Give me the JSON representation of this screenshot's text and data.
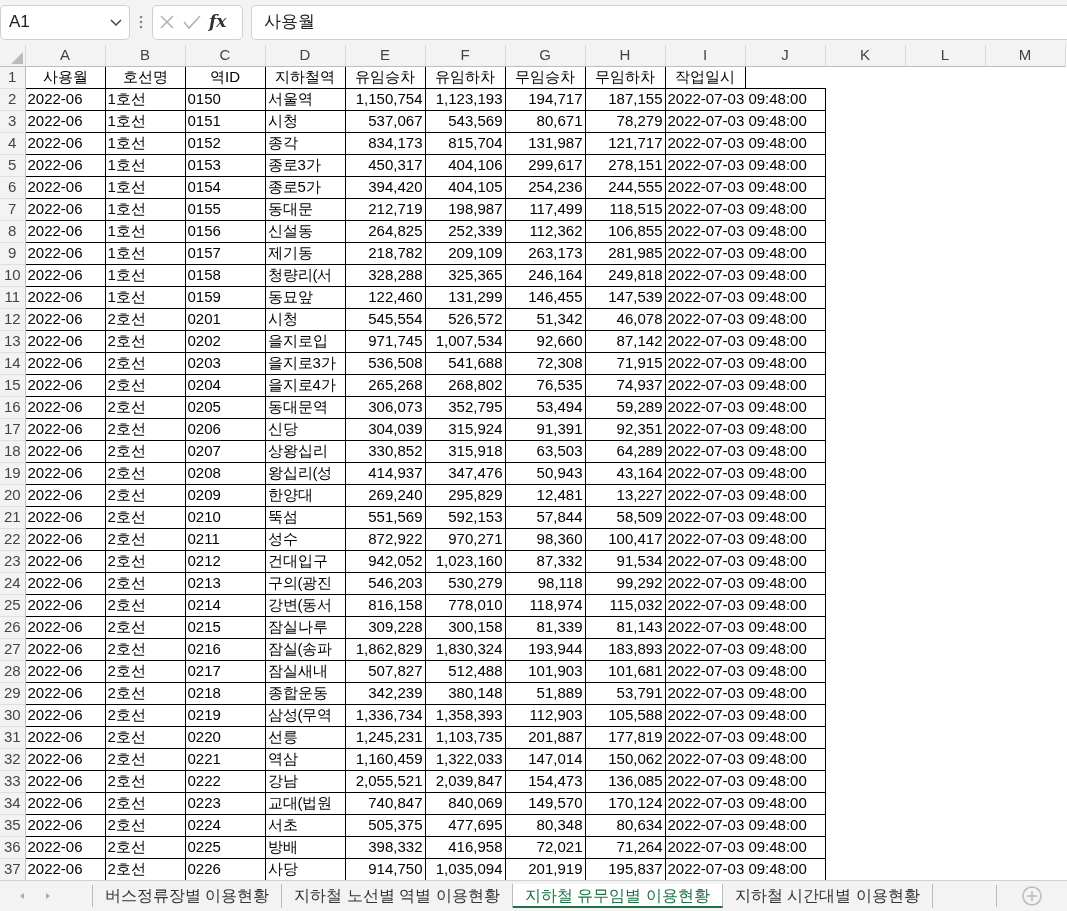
{
  "formula_bar": {
    "name_box": "A1",
    "function_label": "fx",
    "formula": "사용월"
  },
  "columns": [
    "A",
    "B",
    "C",
    "D",
    "E",
    "F",
    "G",
    "H",
    "I",
    "J",
    "K",
    "L",
    "M"
  ],
  "rows": [
    {
      "row_number": "1",
      "kind": "header",
      "cells": [
        "사용월",
        "호선명",
        "역ID",
        "지하철역",
        "유임승차",
        "유임하차",
        "무임승차",
        "무임하차",
        "작업일시"
      ]
    },
    {
      "row_number": "2",
      "kind": "data",
      "cells": [
        "2022-06",
        "1호선",
        "0150",
        "서울역",
        "1,150,754",
        "1,123,193",
        "194,717",
        "187,155",
        "2022-07-03 09:48:00"
      ]
    },
    {
      "row_number": "3",
      "kind": "data",
      "cells": [
        "2022-06",
        "1호선",
        "0151",
        "시청",
        "537,067",
        "543,569",
        "80,671",
        "78,279",
        "2022-07-03 09:48:00"
      ]
    },
    {
      "row_number": "4",
      "kind": "data",
      "cells": [
        "2022-06",
        "1호선",
        "0152",
        "종각",
        "834,173",
        "815,704",
        "131,987",
        "121,717",
        "2022-07-03 09:48:00"
      ]
    },
    {
      "row_number": "5",
      "kind": "data",
      "cells": [
        "2022-06",
        "1호선",
        "0153",
        "종로3가",
        "450,317",
        "404,106",
        "299,617",
        "278,151",
        "2022-07-03 09:48:00"
      ]
    },
    {
      "row_number": "6",
      "kind": "data",
      "cells": [
        "2022-06",
        "1호선",
        "0154",
        "종로5가",
        "394,420",
        "404,105",
        "254,236",
        "244,555",
        "2022-07-03 09:48:00"
      ]
    },
    {
      "row_number": "7",
      "kind": "data",
      "cells": [
        "2022-06",
        "1호선",
        "0155",
        "동대문",
        "212,719",
        "198,987",
        "117,499",
        "118,515",
        "2022-07-03 09:48:00"
      ]
    },
    {
      "row_number": "8",
      "kind": "data",
      "cells": [
        "2022-06",
        "1호선",
        "0156",
        "신설동",
        "264,825",
        "252,339",
        "112,362",
        "106,855",
        "2022-07-03 09:48:00"
      ]
    },
    {
      "row_number": "9",
      "kind": "data",
      "cells": [
        "2022-06",
        "1호선",
        "0157",
        "제기동",
        "218,782",
        "209,109",
        "263,173",
        "281,985",
        "2022-07-03 09:48:00"
      ]
    },
    {
      "row_number": "10",
      "kind": "data",
      "cells": [
        "2022-06",
        "1호선",
        "0158",
        "청량리(서",
        "328,288",
        "325,365",
        "246,164",
        "249,818",
        "2022-07-03 09:48:00"
      ]
    },
    {
      "row_number": "11",
      "kind": "data",
      "cells": [
        "2022-06",
        "1호선",
        "0159",
        "동묘앞",
        "122,460",
        "131,299",
        "146,455",
        "147,539",
        "2022-07-03 09:48:00"
      ]
    },
    {
      "row_number": "12",
      "kind": "data",
      "cells": [
        "2022-06",
        "2호선",
        "0201",
        "시청",
        "545,554",
        "526,572",
        "51,342",
        "46,078",
        "2022-07-03 09:48:00"
      ]
    },
    {
      "row_number": "13",
      "kind": "data",
      "cells": [
        "2022-06",
        "2호선",
        "0202",
        "을지로입",
        "971,745",
        "1,007,534",
        "92,660",
        "87,142",
        "2022-07-03 09:48:00"
      ]
    },
    {
      "row_number": "14",
      "kind": "data",
      "cells": [
        "2022-06",
        "2호선",
        "0203",
        "을지로3가",
        "536,508",
        "541,688",
        "72,308",
        "71,915",
        "2022-07-03 09:48:00"
      ]
    },
    {
      "row_number": "15",
      "kind": "data",
      "cells": [
        "2022-06",
        "2호선",
        "0204",
        "을지로4가",
        "265,268",
        "268,802",
        "76,535",
        "74,937",
        "2022-07-03 09:48:00"
      ]
    },
    {
      "row_number": "16",
      "kind": "data",
      "cells": [
        "2022-06",
        "2호선",
        "0205",
        "동대문역",
        "306,073",
        "352,795",
        "53,494",
        "59,289",
        "2022-07-03 09:48:00"
      ]
    },
    {
      "row_number": "17",
      "kind": "data",
      "cells": [
        "2022-06",
        "2호선",
        "0206",
        "신당",
        "304,039",
        "315,924",
        "91,391",
        "92,351",
        "2022-07-03 09:48:00"
      ]
    },
    {
      "row_number": "18",
      "kind": "data",
      "cells": [
        "2022-06",
        "2호선",
        "0207",
        "상왕십리",
        "330,852",
        "315,918",
        "63,503",
        "64,289",
        "2022-07-03 09:48:00"
      ]
    },
    {
      "row_number": "19",
      "kind": "data",
      "cells": [
        "2022-06",
        "2호선",
        "0208",
        "왕십리(성",
        "414,937",
        "347,476",
        "50,943",
        "43,164",
        "2022-07-03 09:48:00"
      ]
    },
    {
      "row_number": "20",
      "kind": "data",
      "cells": [
        "2022-06",
        "2호선",
        "0209",
        "한양대",
        "269,240",
        "295,829",
        "12,481",
        "13,227",
        "2022-07-03 09:48:00"
      ]
    },
    {
      "row_number": "21",
      "kind": "data",
      "cells": [
        "2022-06",
        "2호선",
        "0210",
        "뚝섬",
        "551,569",
        "592,153",
        "57,844",
        "58,509",
        "2022-07-03 09:48:00"
      ]
    },
    {
      "row_number": "22",
      "kind": "data",
      "cells": [
        "2022-06",
        "2호선",
        "0211",
        "성수",
        "872,922",
        "970,271",
        "98,360",
        "100,417",
        "2022-07-03 09:48:00"
      ]
    },
    {
      "row_number": "23",
      "kind": "data",
      "cells": [
        "2022-06",
        "2호선",
        "0212",
        "건대입구",
        "942,052",
        "1,023,160",
        "87,332",
        "91,534",
        "2022-07-03 09:48:00"
      ]
    },
    {
      "row_number": "24",
      "kind": "data",
      "cells": [
        "2022-06",
        "2호선",
        "0213",
        "구의(광진",
        "546,203",
        "530,279",
        "98,118",
        "99,292",
        "2022-07-03 09:48:00"
      ]
    },
    {
      "row_number": "25",
      "kind": "data",
      "cells": [
        "2022-06",
        "2호선",
        "0214",
        "강변(동서",
        "816,158",
        "778,010",
        "118,974",
        "115,032",
        "2022-07-03 09:48:00"
      ]
    },
    {
      "row_number": "26",
      "kind": "data",
      "cells": [
        "2022-06",
        "2호선",
        "0215",
        "잠실나루",
        "309,228",
        "300,158",
        "81,339",
        "81,143",
        "2022-07-03 09:48:00"
      ]
    },
    {
      "row_number": "27",
      "kind": "data",
      "cells": [
        "2022-06",
        "2호선",
        "0216",
        "잠실(송파",
        "1,862,829",
        "1,830,324",
        "193,944",
        "183,893",
        "2022-07-03 09:48:00"
      ]
    },
    {
      "row_number": "28",
      "kind": "data",
      "cells": [
        "2022-06",
        "2호선",
        "0217",
        "잠실새내",
        "507,827",
        "512,488",
        "101,903",
        "101,681",
        "2022-07-03 09:48:00"
      ]
    },
    {
      "row_number": "29",
      "kind": "data",
      "cells": [
        "2022-06",
        "2호선",
        "0218",
        "종합운동",
        "342,239",
        "380,148",
        "51,889",
        "53,791",
        "2022-07-03 09:48:00"
      ]
    },
    {
      "row_number": "30",
      "kind": "data",
      "cells": [
        "2022-06",
        "2호선",
        "0219",
        "삼성(무역",
        "1,336,734",
        "1,358,393",
        "112,903",
        "105,588",
        "2022-07-03 09:48:00"
      ]
    },
    {
      "row_number": "31",
      "kind": "data",
      "cells": [
        "2022-06",
        "2호선",
        "0220",
        "선릉",
        "1,245,231",
        "1,103,735",
        "201,887",
        "177,819",
        "2022-07-03 09:48:00"
      ]
    },
    {
      "row_number": "32",
      "kind": "data",
      "cells": [
        "2022-06",
        "2호선",
        "0221",
        "역삼",
        "1,160,459",
        "1,322,033",
        "147,014",
        "150,062",
        "2022-07-03 09:48:00"
      ]
    },
    {
      "row_number": "33",
      "kind": "data",
      "cells": [
        "2022-06",
        "2호선",
        "0222",
        "강남",
        "2,055,521",
        "2,039,847",
        "154,473",
        "136,085",
        "2022-07-03 09:48:00"
      ]
    },
    {
      "row_number": "34",
      "kind": "data",
      "cells": [
        "2022-06",
        "2호선",
        "0223",
        "교대(법원",
        "740,847",
        "840,069",
        "149,570",
        "170,124",
        "2022-07-03 09:48:00"
      ]
    },
    {
      "row_number": "35",
      "kind": "data",
      "cells": [
        "2022-06",
        "2호선",
        "0224",
        "서초",
        "505,375",
        "477,695",
        "80,348",
        "80,634",
        "2022-07-03 09:48:00"
      ]
    },
    {
      "row_number": "36",
      "kind": "data",
      "cells": [
        "2022-06",
        "2호선",
        "0225",
        "방배",
        "398,332",
        "416,958",
        "72,021",
        "71,264",
        "2022-07-03 09:48:00"
      ]
    },
    {
      "row_number": "37",
      "kind": "data",
      "cells": [
        "2022-06",
        "2호선",
        "0226",
        "사당",
        "914,750",
        "1,035,094",
        "201,919",
        "195,837",
        "2022-07-03 09:48:00"
      ]
    }
  ],
  "sheet_tabs": [
    {
      "label": "버스정류장별 이용현황",
      "selected": false
    },
    {
      "label": "지하철 노선별 역별 이용현황",
      "selected": false
    },
    {
      "label": "지하철 유무임별 이용현황",
      "selected": true
    },
    {
      "label": "지하철 시간대별 이용현황",
      "selected": false
    }
  ]
}
